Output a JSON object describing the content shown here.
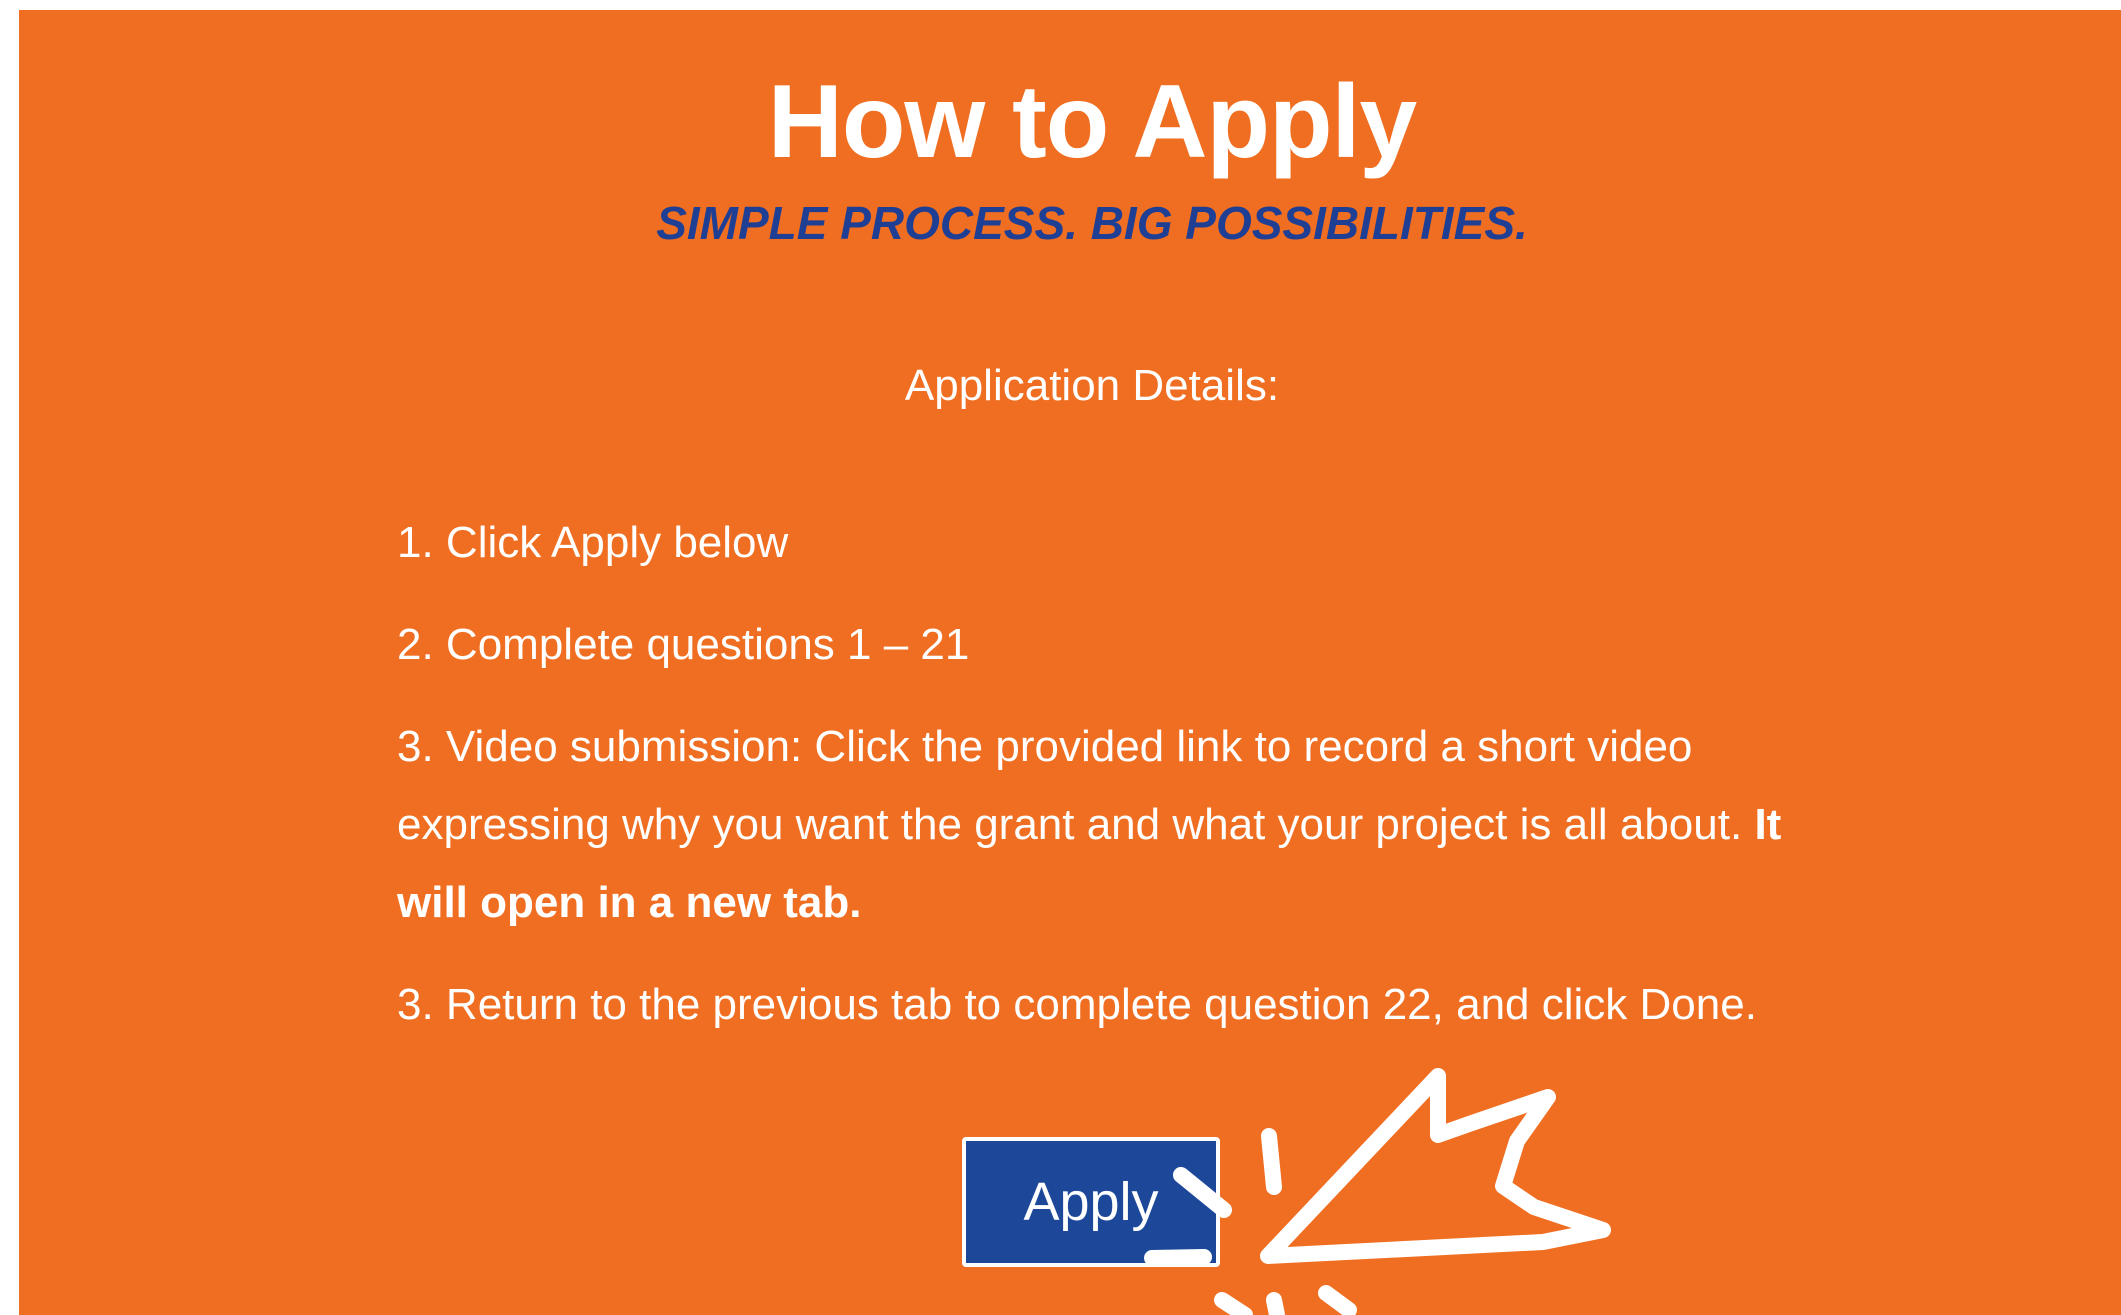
{
  "section": {
    "title": "How to Apply",
    "tagline": "SIMPLE PROCESS. BIG POSSIBILITIES.",
    "details_heading": "Application Details:"
  },
  "steps": {
    "step1": "1. Click Apply below",
    "step2": "2. Complete questions 1 – 21",
    "step3_text": "3. Video submission: Click the provided link to record a short video expressing why you want the grant and what your project is all about.",
    "step3_bold": "It will open in a new tab.",
    "step4": "3. Return to the previous tab to complete question 22, and click Done."
  },
  "apply_button": {
    "label": "Apply"
  },
  "colors": {
    "background": "#f06e21",
    "accent_blue": "#1d4899",
    "tagline_blue": "#1f3f94",
    "text": "#ffffff"
  },
  "icons": {
    "cursor": "click-cursor-icon"
  }
}
